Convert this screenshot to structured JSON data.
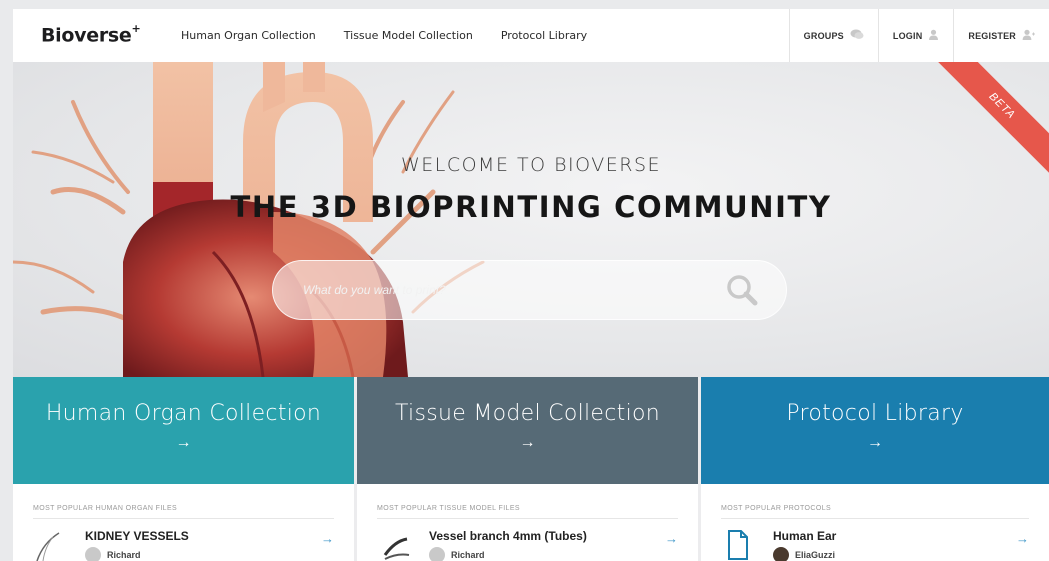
{
  "nav": {
    "logo": "Bioverse",
    "logo_sup": "+",
    "links": [
      "Human Organ Collection",
      "Tissue Model Collection",
      "Protocol Library"
    ],
    "right": [
      {
        "label": "GROUPS",
        "icon": "chat-icon"
      },
      {
        "label": "LOGIN",
        "icon": "user-icon"
      },
      {
        "label": "REGISTER",
        "icon": "add-user-icon"
      }
    ]
  },
  "hero": {
    "welcome": "WELCOME TO BIOVERSE",
    "headline": "THE 3D BIOPRINTING COMMUNITY",
    "search_placeholder": "What do you want to print?",
    "badge": "BETA"
  },
  "collections": [
    {
      "title": "Human Organ Collection",
      "arrow": "→",
      "color": "#2aa2ad",
      "caption": "MOST POPULAR HUMAN ORGAN FILES",
      "item": {
        "title": "KIDNEY VESSELS",
        "author": "Richard",
        "arrow": "→"
      }
    },
    {
      "title": "Tissue Model Collection",
      "arrow": "→",
      "color": "#566a76",
      "caption": "MOST POPULAR TISSUE MODEL FILES",
      "item": {
        "title": "Vessel branch 4mm (Tubes)",
        "author": "Richard",
        "arrow": "→"
      }
    },
    {
      "title": "Protocol Library",
      "arrow": "→",
      "color": "#1a7eae",
      "caption": "MOST POPULAR PROTOCOLS",
      "item": {
        "title": "Human Ear",
        "author": "EliaGuzzi",
        "arrow": "→"
      }
    }
  ]
}
